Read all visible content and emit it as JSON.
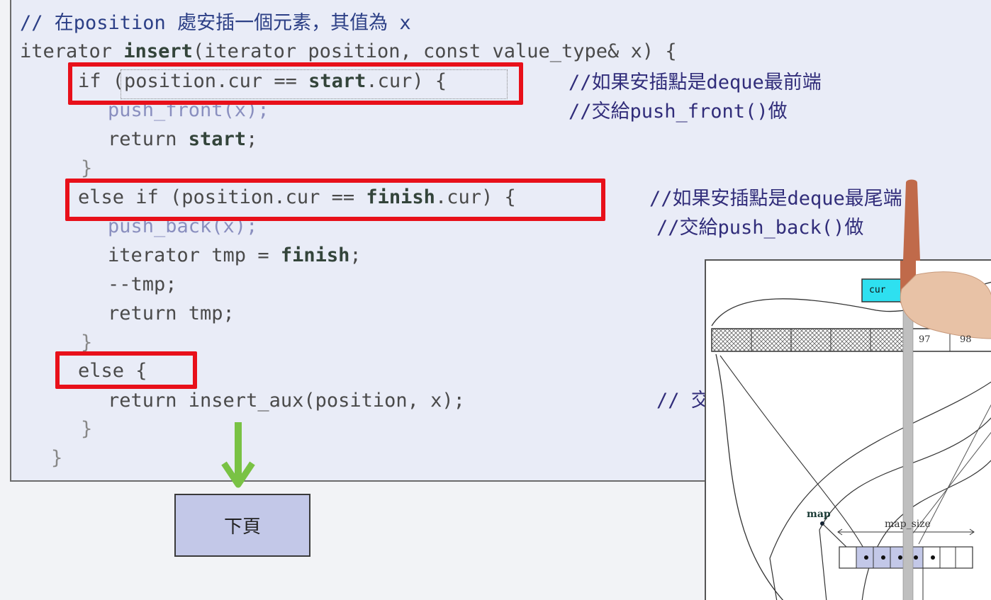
{
  "code": {
    "header_comment": "// 在position 處安插一個元素，其值為 x",
    "signature": {
      "pre": "iterator ",
      "fn": "insert",
      "post": "(iterator position, const value_type& x) {"
    },
    "if_line": {
      "pre": "if (position.cur == ",
      "kw": "start",
      "post": ".cur) {"
    },
    "push_front": "push_front(x);",
    "return_start": {
      "pre": "return ",
      "kw": "start",
      "post": ";"
    },
    "close1": "}",
    "elseif_line": {
      "pre": "else if (position.cur == ",
      "kw": "finish",
      "post": ".cur) {"
    },
    "push_back": "push_back(x);",
    "tmp_line": {
      "pre": "iterator tmp = ",
      "kw": "finish",
      "post": ";"
    },
    "dec_tmp": "--tmp;",
    "return_tmp": "return tmp;",
    "close2": "}",
    "else_line": "else {",
    "return_aux": "return insert_aux(position, x);",
    "close3": "}",
    "close4": "}"
  },
  "comments": {
    "front1": "//如果安插點是deque最前端",
    "front2": "//交給push_front()做",
    "back1": "//如果安插點是deque最尾端",
    "back2": "//交給push_back()做",
    "aux": "// 交"
  },
  "next_button": "下頁",
  "diagram": {
    "cur_label": "cur",
    "buffer_values": [
      "97",
      "98"
    ],
    "map_label": "map",
    "map_size_label": "map_size"
  },
  "colors": {
    "highlight": "#e8101a",
    "arrow": "#79c244",
    "panel_bg": "#e9ecf7",
    "button_bg": "#c3c8e8",
    "cur_box": "#2ee0f0"
  }
}
